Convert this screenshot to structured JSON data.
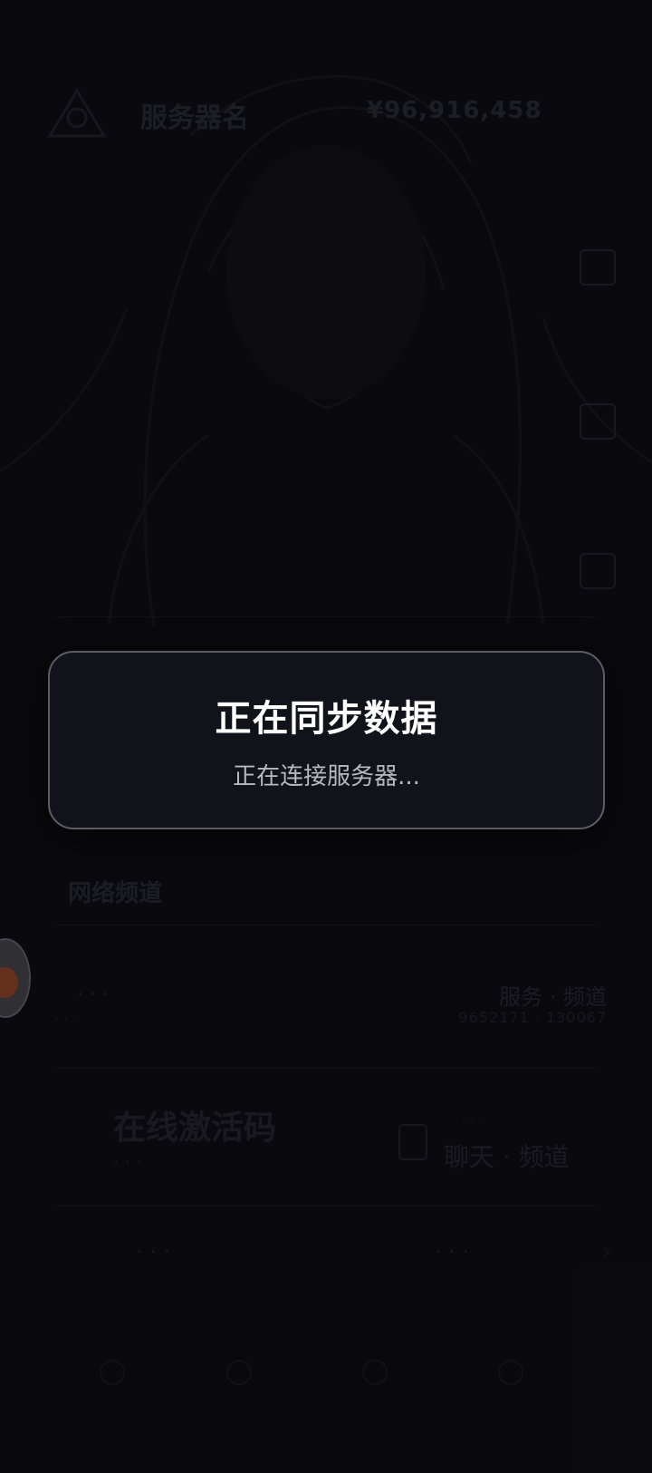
{
  "background": {
    "header": {
      "server_name": "服务器名",
      "balance": "¥96,916,458"
    },
    "section_title": "网络频道",
    "list_item": {
      "left_label": "· · ·",
      "left_sub": "· · ·",
      "right_label": "服务 · 频道",
      "right_sub": "9652171 · 130067"
    },
    "card": {
      "title": "在线激活码",
      "subtitle": "· · ·",
      "right_top": "· · ·",
      "right_label": "聊天 · 频道"
    },
    "bottom_row": {
      "left": "· · ·",
      "right": "· · ·",
      "chevron": "›"
    }
  },
  "dialog": {
    "title": "正在同步数据",
    "status": "正在连接服务器..."
  },
  "colors": {
    "dialog_bg": "#12121a",
    "dialog_border": "#5c5c66",
    "title": "#ffffff",
    "status": "#b8b8c0",
    "screen_bg": "#0d0d12"
  },
  "icons": {
    "logo": "logo-icon",
    "avatar": "floating-avatar-icon",
    "phone": "phone-icon"
  }
}
